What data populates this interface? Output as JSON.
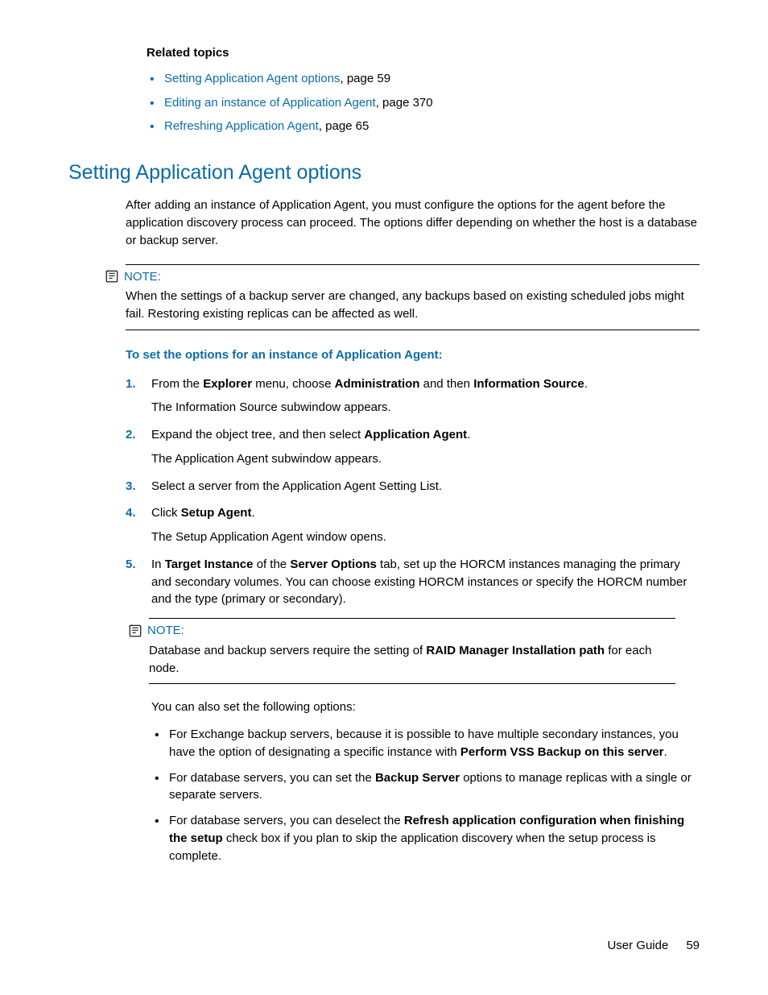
{
  "related": {
    "heading": "Related topics",
    "items": [
      {
        "link": "Setting Application Agent options",
        "suffix": ", page 59"
      },
      {
        "link": "Editing an instance of Application Agent",
        "suffix": ", page 370"
      },
      {
        "link": "Refreshing Application Agent",
        "suffix": ", page 65"
      }
    ]
  },
  "section_title": "Setting Application Agent options",
  "intro": "After adding an instance of Application Agent, you must configure the options for the agent before the application discovery process can proceed. The options differ depending on whether the host is a database or backup server.",
  "note1": {
    "label": "NOTE:",
    "body": "When the settings of a backup server are changed, any backups based on existing scheduled jobs might fail. Restoring existing replicas can be affected as well."
  },
  "subhead": "To set the options for an instance of Application Agent:",
  "steps": {
    "s1": {
      "pre": "From the ",
      "b1": "Explorer",
      "mid1": " menu, choose ",
      "b2": "Administration",
      "mid2": " and then ",
      "b3": "Information Source",
      "post": ".",
      "sub": "The Information Source subwindow appears."
    },
    "s2": {
      "pre": "Expand the object tree, and then select ",
      "b1": "Application Agent",
      "post": ".",
      "sub": "The Application Agent subwindow appears."
    },
    "s3": {
      "text": "Select a server from the Application Agent Setting List."
    },
    "s4": {
      "pre": "Click ",
      "b1": "Setup Agent",
      "post": ".",
      "sub": "The Setup Application Agent window opens."
    },
    "s5": {
      "pre": "In ",
      "b1": "Target Instance",
      "mid1": " of the ",
      "b2": "Server Options",
      "post": " tab, set up the HORCM instances managing the primary and secondary volumes. You can choose existing HORCM instances or specify the HORCM number and the type (primary or secondary)."
    }
  },
  "note2": {
    "label": "NOTE:",
    "pre": "Database and backup servers require the setting of ",
    "b1": "RAID Manager Installation path",
    "post": " for each node."
  },
  "post_para": "You can also set the following options:",
  "options": {
    "o1": {
      "pre": "For Exchange backup servers, because it is possible to have multiple secondary instances, you have the option of designating a specific instance with ",
      "b1": "Perform VSS Backup on this server",
      "post": "."
    },
    "o2": {
      "pre": "For database servers, you can set the ",
      "b1": "Backup Server",
      "post": " options to manage replicas with a single or separate servers."
    },
    "o3": {
      "pre": "For database servers, you can deselect the ",
      "b1": "Refresh application configuration when finishing the setup",
      "post": " check box if you plan to skip the application discovery when the setup process is complete."
    }
  },
  "footer": {
    "label": "User Guide",
    "page": "59"
  }
}
